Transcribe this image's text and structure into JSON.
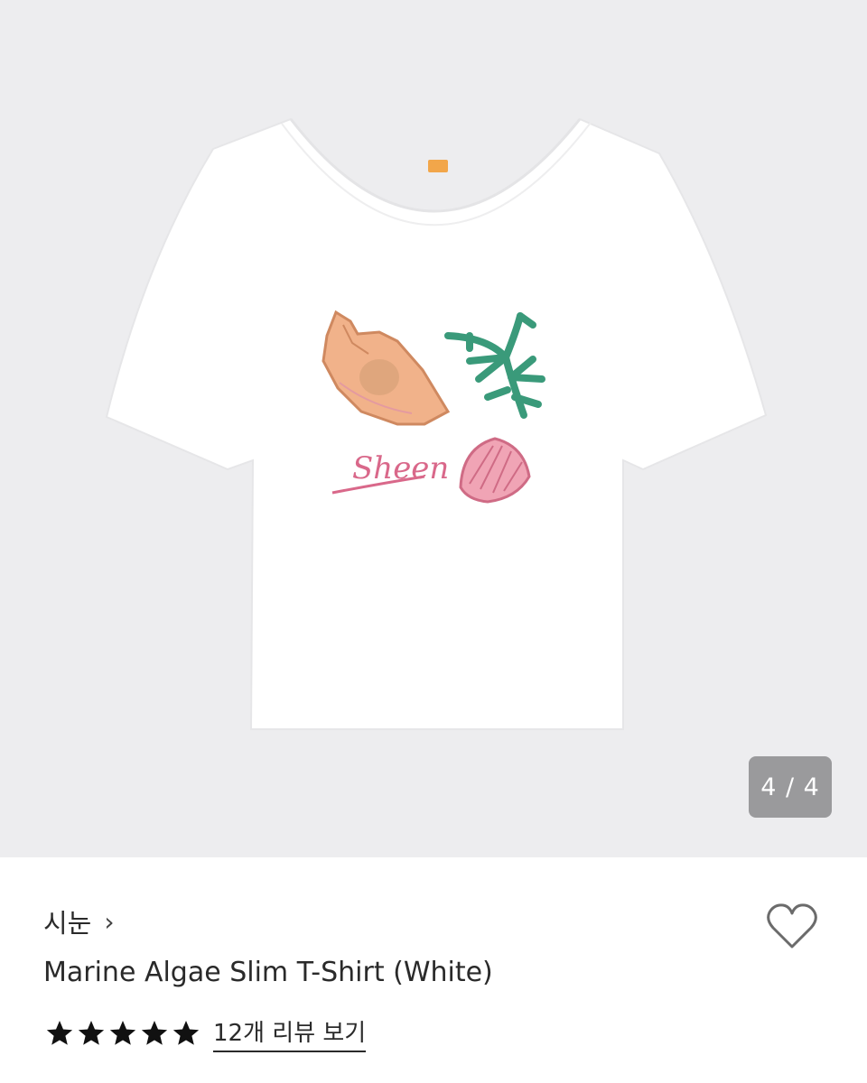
{
  "gallery": {
    "image_alt": "White short-sleeve scoop-neck t-shirt with watercolor print of a conch shell, green seaweed, pink scallop shell and script text",
    "print_text": "Sheen",
    "counter": "4 / 4",
    "current_page": 4,
    "total_pages": 4
  },
  "product": {
    "brand": "시눈",
    "brand_chevron": "›",
    "name": "Marine Algae Slim T-Shirt (White)",
    "rating": 5,
    "max_rating": 5,
    "review_link": "12개 리뷰 보기"
  },
  "icons": {
    "wishlist": "heart-outline-icon",
    "star": "star-filled-icon"
  },
  "colors": {
    "gallery_bg": "#ededef",
    "counter_bg": "#9a9a9c",
    "text": "#1a1a1a"
  }
}
